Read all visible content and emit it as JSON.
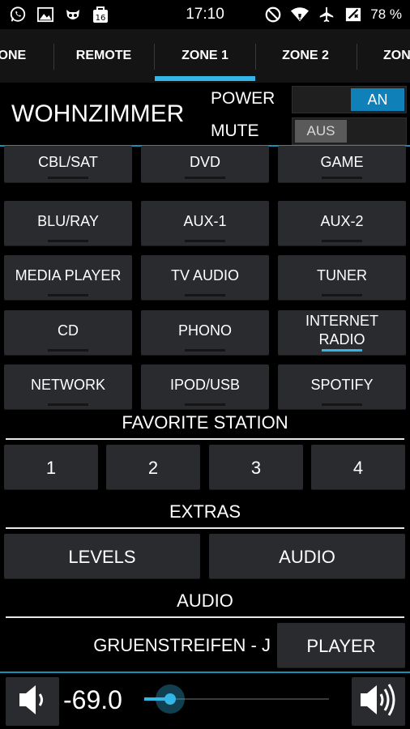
{
  "status_bar": {
    "time": "17:10",
    "battery": "78 %",
    "left_icons": [
      "whatsapp-icon",
      "gallery-icon",
      "cyanogen-icon",
      "notification-count-icon"
    ],
    "notification_count": "16",
    "right_icons": [
      "dnd-icon",
      "wifi-icon",
      "airplane-icon",
      "no-sim-icon"
    ]
  },
  "tabs": [
    {
      "label": "ZONE"
    },
    {
      "label": "REMOTE"
    },
    {
      "label": "ZONE 1"
    },
    {
      "label": "ZONE 2"
    },
    {
      "label": "ZON"
    }
  ],
  "active_tab": "ZONE 1",
  "header": {
    "room": "WOHNZIMMER",
    "power_label": "POWER",
    "power_state": "AN",
    "mute_label": "MUTE",
    "mute_state": "AUS"
  },
  "sources": [
    {
      "label": "CBL/SAT"
    },
    {
      "label": "DVD"
    },
    {
      "label": "GAME"
    },
    {
      "label": "BLU/RAY"
    },
    {
      "label": "AUX-1"
    },
    {
      "label": "AUX-2"
    },
    {
      "label": "MEDIA PLAYER"
    },
    {
      "label": "TV AUDIO"
    },
    {
      "label": "TUNER"
    },
    {
      "label": "CD"
    },
    {
      "label": "PHONO"
    },
    {
      "label": "INTERNET RADIO",
      "active": true
    },
    {
      "label": "NETWORK"
    },
    {
      "label": "IPOD/USB"
    },
    {
      "label": "SPOTIFY"
    }
  ],
  "favorite": {
    "title": "FAVORITE STATION",
    "stations": [
      "1",
      "2",
      "3",
      "4"
    ]
  },
  "extras": {
    "title": "EXTRAS",
    "levels_label": "LEVELS",
    "audio_label": "AUDIO"
  },
  "audio": {
    "title": "AUDIO",
    "now_playing": "GRUENSTREIFEN - J",
    "player_label": "PLAYER"
  },
  "volume": {
    "value": "-69.0",
    "level_fraction": 0.14
  },
  "colors": {
    "accent": "#33b5e5",
    "button_bg": "#2a2b2e",
    "switch_on": "#0f80b8"
  }
}
